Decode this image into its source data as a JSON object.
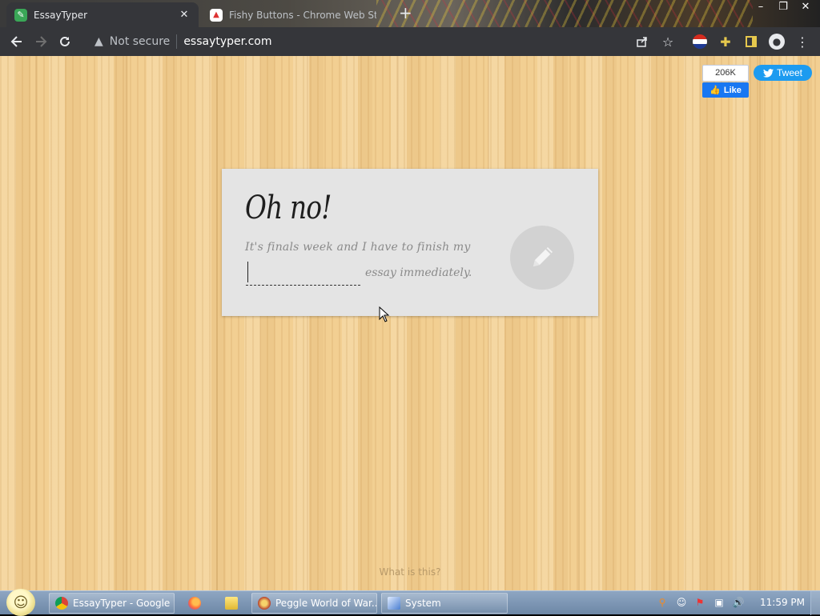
{
  "browser": {
    "tabs": [
      {
        "title": "EssayTyper",
        "active": true
      },
      {
        "title": "Fishy Buttons - Chrome Web St...",
        "active": false
      }
    ],
    "new_tab_symbol": "+",
    "omnibox": {
      "security_label": "Not secure",
      "url": "essaytyper.com"
    },
    "toolbar_icons": [
      "share-icon",
      "star-icon",
      "flag-extension-icon",
      "puzzle-icon",
      "sidepanel-icon",
      "profile-icon",
      "kebab-menu-icon"
    ]
  },
  "page": {
    "social": {
      "like_count": "206K",
      "like_label": "Like",
      "tweet_label": "Tweet"
    },
    "card": {
      "heading": "Oh no!",
      "line1": "It's finals week and I have to finish my",
      "line2": "essay immediately.",
      "input_value": ""
    },
    "footer_link": "What is this?"
  },
  "taskbar": {
    "buttons": [
      {
        "label": "EssayTyper - Google ..."
      },
      {
        "label": "Peggle World of War..."
      },
      {
        "label": "System"
      }
    ],
    "clock": "11:59 PM"
  },
  "colors": {
    "wood": "#f2cf92",
    "card": "#e4e4e4",
    "facebook": "#1877f2",
    "twitter": "#1d9bf0",
    "chrome_toolbar": "#35363a"
  }
}
